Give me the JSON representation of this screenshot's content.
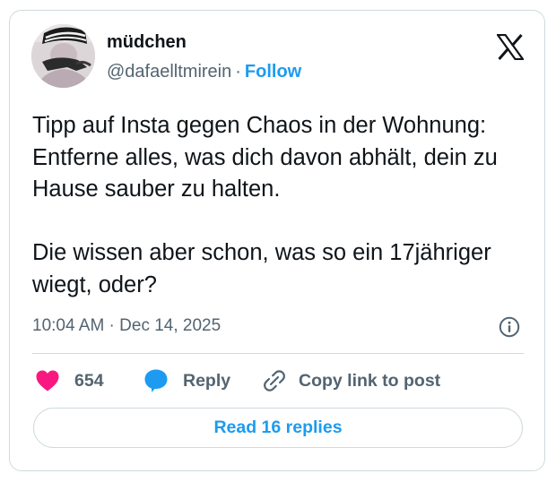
{
  "author": {
    "display_name": "müdchen",
    "handle": "@dafaelltmirein",
    "separator": "·",
    "follow_label": "Follow"
  },
  "tweet": {
    "paragraphs": [
      "Tipp auf Insta gegen Chaos in der Wohnung: Entferne alles, was dich davon abhält, dein zu Hause sauber zu halten.",
      "Die wissen aber schon, was so ein 17jähriger wiegt, oder?"
    ],
    "timestamp": "10:04 AM · Dec 14, 2025"
  },
  "actions": {
    "like_count": "654",
    "reply_label": "Reply",
    "copy_label": "Copy link to post"
  },
  "read_replies_label": "Read 16 replies",
  "icons": {
    "brand": "x-logo-icon",
    "info": "info-icon",
    "like": "heart-icon",
    "reply": "speech-bubble-icon",
    "copy": "link-icon"
  },
  "colors": {
    "accent": "#1d9bf0",
    "like": "#f91880",
    "secondary_text": "#536471",
    "border": "#cfd9de"
  }
}
